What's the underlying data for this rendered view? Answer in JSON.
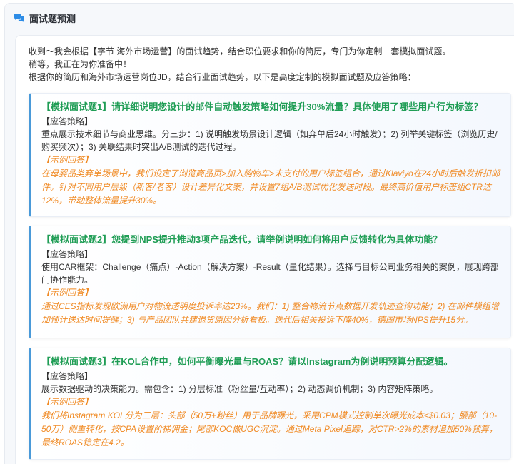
{
  "header": {
    "title": "面试题预测",
    "icon": "chat-bubbles-icon"
  },
  "intro": [
    "收到～我会根据【字节 海外市场运营】的面试趋势，结合职位要求和你的简历，专门为你定制一套模拟面试题。",
    "稍等，我正在为你准备中！",
    "根据你的简历和海外市场运营岗位JD，结合行业面试趋势，以下是高度定制的模拟面试题及应答策略："
  ],
  "questions": [
    {
      "title": "【模拟面试题1】请详细说明您设计的邮件自动触发策略如何提升30%流量？具体使用了哪些用户行为标签？",
      "strategy_label": "【应答策略】",
      "strategy": "重点展示技术细节与商业思维。分三步：1) 说明触发场景设计逻辑（如弃单后24小时触发）；2) 列举关键标签（浏览历史/购买频次）；3) 关联结果时突出A/B测试的迭代过程。",
      "example_label": "【示例回答】",
      "example": "在母婴品类弃单场景中，我们设定了浏览商品页>加入购物车>未支付的用户标签组合，通过Klaviyo在24小时后触发折扣邮件。针对不同用户层级（新客/老客）设计差异化文案，并设置7组A/B测试优化发送时段。最终高价值用户标签组CTR达12%，带动整体流量提升30%。"
    },
    {
      "title": "【模拟面试题2】您提到NPS提升推动3项产品迭代，请举例说明如何将用户反馈转化为具体功能？",
      "strategy_label": "【应答策略】",
      "strategy": "使用CAR框架：Challenge（痛点）-Action（解决方案）-Result（量化结果）。选择与目标公司业务相关的案例，展现跨部门协作能力。",
      "example_label": "【示例回答】",
      "example": "通过CES指标发现欧洲用户对物流透明度投诉率达23%。我们：1) 整合物流节点数据开发轨迹查询功能；2) 在邮件模组增加预计送达时间提醒；3) 与产品团队共建退货原因分析看板。迭代后相关投诉下降40%，德国市场NPS提升15分。"
    },
    {
      "title": "【模拟面试题3】在KOL合作中，如何平衡曝光量与ROAS？请以Instagram为例说明预算分配逻辑。",
      "strategy_label": "【应答策略】",
      "strategy": "展示数据驱动的决策能力。需包含：1) 分层标准（粉丝量/互动率）；2) 动态调价机制；3) 内容矩阵策略。",
      "example_label": "【示例回答】",
      "example": "我们将Instagram KOL分为三层：头部（50万+粉丝）用于品牌曝光，采用CPM模式控制单次曝光成本<$0.03；腰部（10-50万）侧重转化，按CPA设置阶梯佣金；尾部KOC做UGC沉淀。通过Meta Pixel追踪，对CTR>2%的素材追加50%预算，最终ROAS稳定在4.2。"
    }
  ],
  "colors": {
    "accent": "#4a9ad9",
    "question": "#1f9d55",
    "example": "#f08a24"
  }
}
